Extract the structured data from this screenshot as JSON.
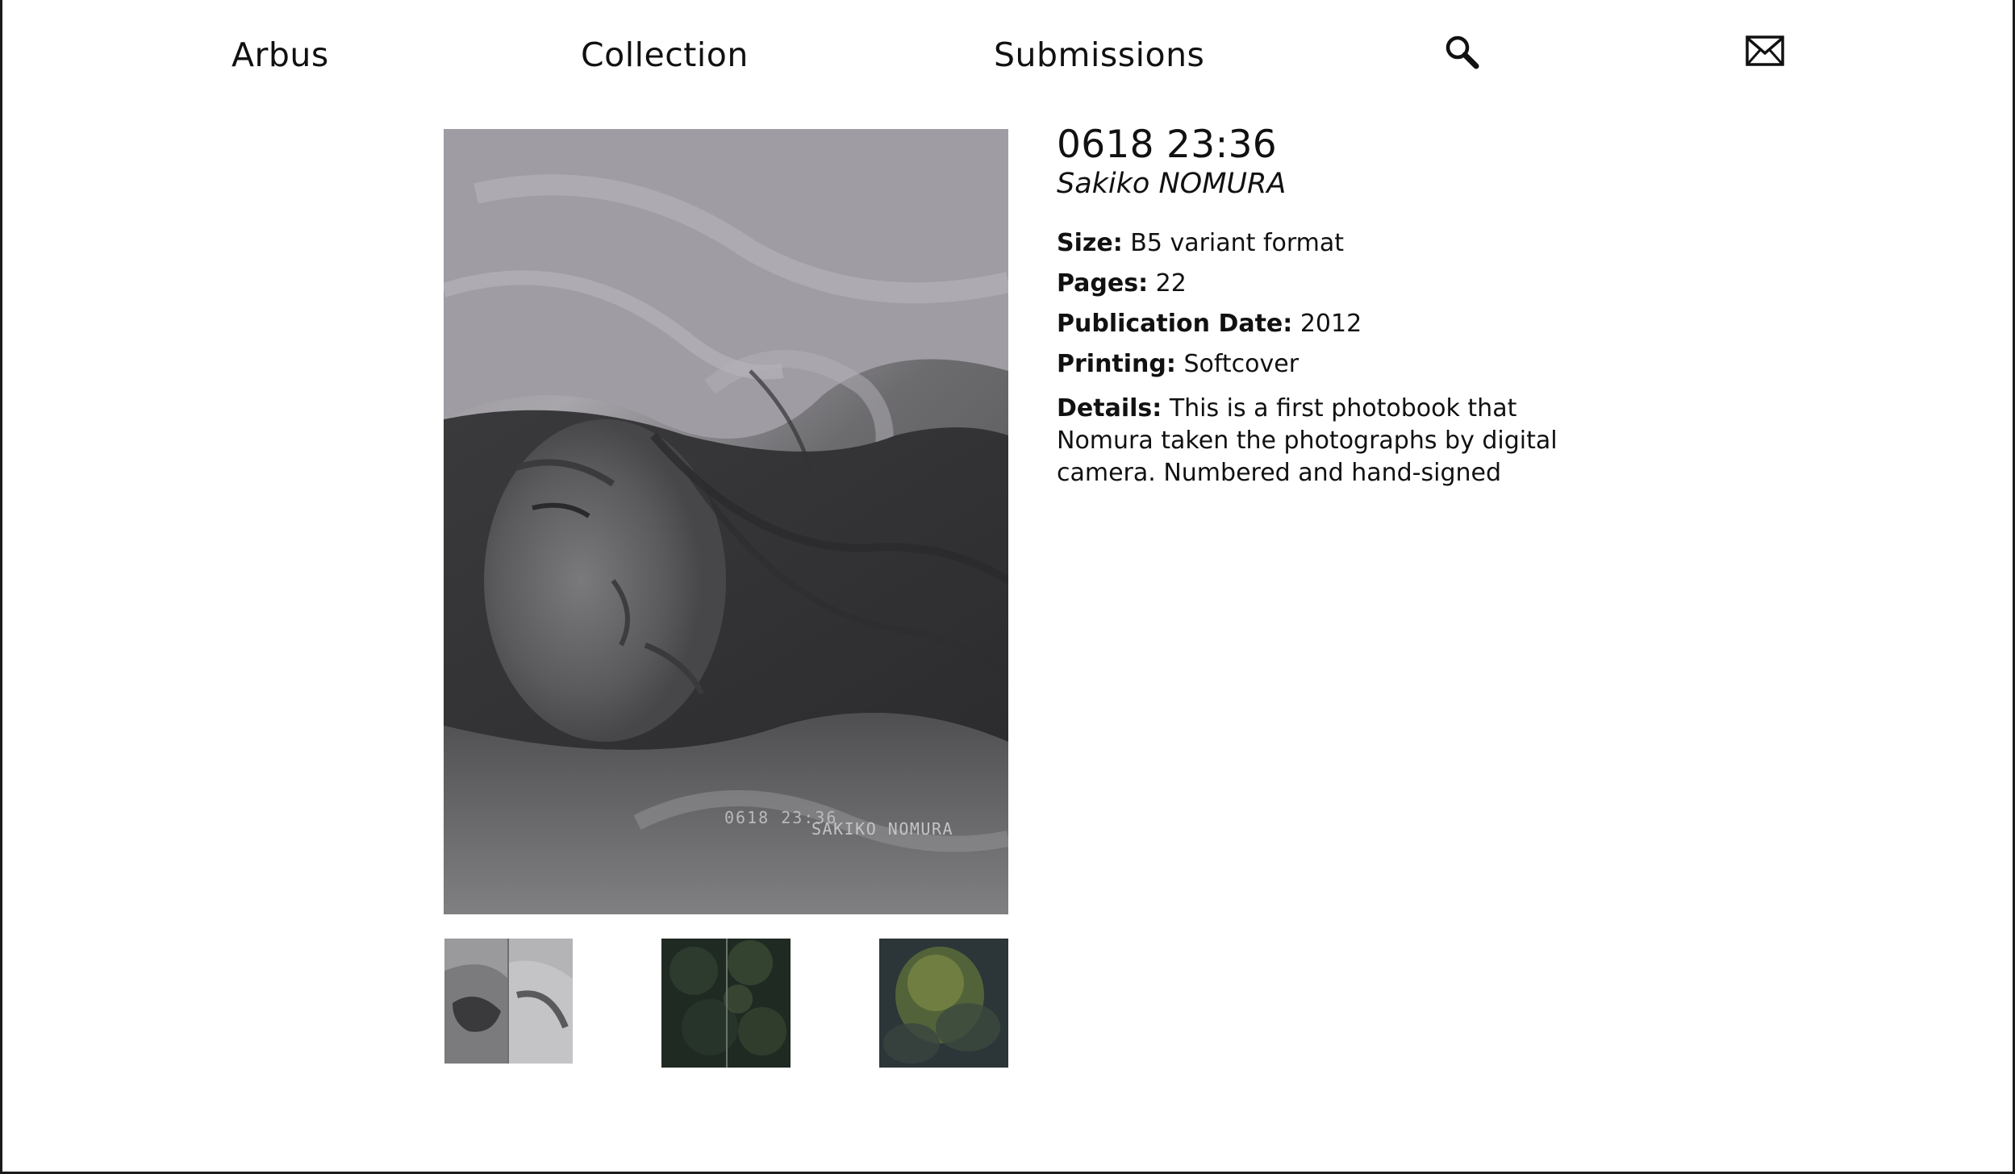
{
  "nav": {
    "home_label": "Arbus",
    "collection_label": "Collection",
    "submissions_label": "Submissions",
    "search_icon": "search-icon",
    "mail_icon": "mail-icon"
  },
  "book": {
    "title": "0618 23:36",
    "artist": "Sakiko NOMURA",
    "cover_text_title": "0618 23:36",
    "cover_text_artist": "SAKIKO NOMURA",
    "size_label": "Size:",
    "size_value": "B5 variant format",
    "pages_label": "Pages:",
    "pages_value": "22",
    "date_label": "Publication Date:",
    "date_value": "2012",
    "printing_label": "Printing:",
    "printing_value": "Softcover",
    "details_label": "Details:",
    "details_value": "This is a first photobook that Nomura taken the photographs by digital camera. Numbered and hand-signed"
  },
  "thumbnails": [
    {
      "name": "thumbnail-1"
    },
    {
      "name": "thumbnail-2"
    },
    {
      "name": "thumbnail-3"
    }
  ]
}
